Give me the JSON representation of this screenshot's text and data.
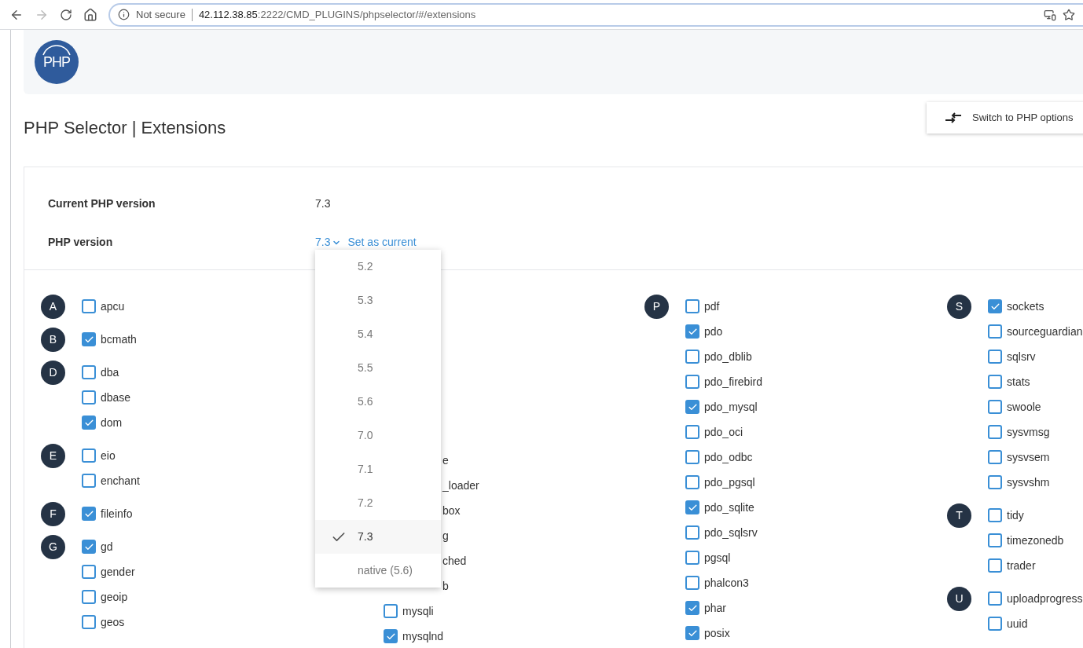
{
  "browser": {
    "security": "Not secure",
    "url_host": "42.112.38.85",
    "url_path": ":2222/CMD_PLUGINS/phpselector/#/extensions"
  },
  "header": {
    "logo_text": "PHP"
  },
  "title": "PHP Selector | Extensions",
  "switch_button": "Switch to PHP options",
  "info": {
    "current_label": "Current PHP version",
    "current_value": "7.3",
    "version_label": "PHP version",
    "version_value": "7.3",
    "set_current": "Set as current"
  },
  "version_menu": [
    {
      "label": "5.2",
      "selected": false
    },
    {
      "label": "5.3",
      "selected": false
    },
    {
      "label": "5.4",
      "selected": false
    },
    {
      "label": "5.5",
      "selected": false
    },
    {
      "label": "5.6",
      "selected": false
    },
    {
      "label": "7.0",
      "selected": false
    },
    {
      "label": "7.1",
      "selected": false
    },
    {
      "label": "7.2",
      "selected": false
    },
    {
      "label": "7.3",
      "selected": true
    },
    {
      "label": "native (5.6)",
      "selected": false
    }
  ],
  "columns": [
    {
      "groups": [
        {
          "letter": "A",
          "items": [
            {
              "kind": "checkbox",
              "name": "apcu",
              "checked": false
            }
          ]
        },
        {
          "letter": "B",
          "items": [
            {
              "kind": "checkbox",
              "name": "bcmath",
              "checked": true
            }
          ]
        },
        {
          "letter": "D",
          "items": [
            {
              "kind": "checkbox",
              "name": "dba",
              "checked": false
            },
            {
              "kind": "checkbox",
              "name": "dbase",
              "checked": false
            },
            {
              "kind": "checkbox",
              "name": "dom",
              "checked": true
            }
          ]
        },
        {
          "letter": "E",
          "items": [
            {
              "kind": "checkbox",
              "name": "eio",
              "checked": false
            },
            {
              "kind": "checkbox",
              "name": "enchant",
              "checked": false
            }
          ]
        },
        {
          "letter": "F",
          "items": [
            {
              "kind": "checkbox",
              "name": "fileinfo",
              "checked": true
            }
          ]
        },
        {
          "letter": "G",
          "items": [
            {
              "kind": "checkbox",
              "name": "gd",
              "checked": true
            },
            {
              "kind": "checkbox",
              "name": "gender",
              "checked": false
            },
            {
              "kind": "checkbox",
              "name": "geoip",
              "checked": false
            },
            {
              "kind": "checkbox",
              "name": "geos",
              "checked": false
            }
          ]
        }
      ]
    },
    {
      "groups": [
        {
          "items": [
            {
              "kind": "clipped",
              "name": "e"
            },
            {
              "kind": "clipped",
              "name": "_loader"
            },
            {
              "kind": "clipped",
              "name": "box"
            },
            {
              "kind": "clipped",
              "name": "g"
            },
            {
              "kind": "clipped",
              "name": "ched"
            },
            {
              "kind": "clipped",
              "name": "b"
            },
            {
              "kind": "checkbox",
              "name": "mysqli",
              "checked": false
            },
            {
              "kind": "checkbox",
              "name": "mysqlnd",
              "checked": true
            }
          ]
        }
      ]
    },
    {
      "groups": [
        {
          "letter": "P",
          "items": [
            {
              "kind": "checkbox",
              "name": "pdf",
              "checked": false
            },
            {
              "kind": "checkbox",
              "name": "pdo",
              "checked": true
            },
            {
              "kind": "checkbox",
              "name": "pdo_dblib",
              "checked": false
            },
            {
              "kind": "checkbox",
              "name": "pdo_firebird",
              "checked": false
            },
            {
              "kind": "checkbox",
              "name": "pdo_mysql",
              "checked": true
            },
            {
              "kind": "checkbox",
              "name": "pdo_oci",
              "checked": false
            },
            {
              "kind": "checkbox",
              "name": "pdo_odbc",
              "checked": false
            },
            {
              "kind": "checkbox",
              "name": "pdo_pgsql",
              "checked": false
            },
            {
              "kind": "checkbox",
              "name": "pdo_sqlite",
              "checked": true
            },
            {
              "kind": "checkbox",
              "name": "pdo_sqlsrv",
              "checked": false
            },
            {
              "kind": "checkbox",
              "name": "pgsql",
              "checked": false
            },
            {
              "kind": "checkbox",
              "name": "phalcon3",
              "checked": false
            },
            {
              "kind": "checkbox",
              "name": "phar",
              "checked": true
            },
            {
              "kind": "checkbox",
              "name": "posix",
              "checked": true
            }
          ]
        }
      ]
    },
    {
      "groups": [
        {
          "letter": "S",
          "items": [
            {
              "kind": "checkbox",
              "name": "sockets",
              "checked": true
            },
            {
              "kind": "checkbox",
              "name": "sourceguardian",
              "checked": false
            },
            {
              "kind": "checkbox",
              "name": "sqlsrv",
              "checked": false
            },
            {
              "kind": "checkbox",
              "name": "stats",
              "checked": false
            },
            {
              "kind": "checkbox",
              "name": "swoole",
              "checked": false
            },
            {
              "kind": "checkbox",
              "name": "sysvmsg",
              "checked": false
            },
            {
              "kind": "checkbox",
              "name": "sysvsem",
              "checked": false
            },
            {
              "kind": "checkbox",
              "name": "sysvshm",
              "checked": false
            }
          ]
        },
        {
          "letter": "T",
          "items": [
            {
              "kind": "checkbox",
              "name": "tidy",
              "checked": false
            },
            {
              "kind": "checkbox",
              "name": "timezonedb",
              "checked": false
            },
            {
              "kind": "checkbox",
              "name": "trader",
              "checked": false
            }
          ]
        },
        {
          "letter": "U",
          "items": [
            {
              "kind": "checkbox",
              "name": "uploadprogress",
              "checked": false
            },
            {
              "kind": "checkbox",
              "name": "uuid",
              "checked": false
            }
          ]
        }
      ]
    }
  ]
}
